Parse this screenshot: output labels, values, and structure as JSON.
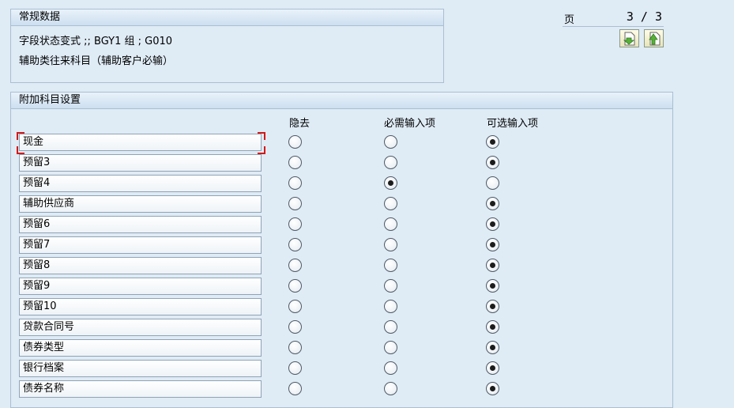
{
  "general": {
    "title": "常规数据",
    "field_status_line": "字段状态变式 ;; BGY1      组 ; G010",
    "description": "辅助类往来科目（辅助客户必输）"
  },
  "pager": {
    "label": "页",
    "value": "3 / 3",
    "prev_icon": "page-down-icon",
    "next_icon": "page-up-icon"
  },
  "settings": {
    "title": "附加科目设置",
    "columns": [
      "隐去",
      "必需输入项",
      "可选输入项"
    ],
    "rows": [
      {
        "label": "现金",
        "selected": 2
      },
      {
        "label": "预留3",
        "selected": 2
      },
      {
        "label": "预留4",
        "selected": 1
      },
      {
        "label": "辅助供应商",
        "selected": 2
      },
      {
        "label": "预留6",
        "selected": 2
      },
      {
        "label": "预留7",
        "selected": 2
      },
      {
        "label": "预留8",
        "selected": 2
      },
      {
        "label": "预留9",
        "selected": 2
      },
      {
        "label": "预留10",
        "selected": 2
      },
      {
        "label": "贷款合同号",
        "selected": 2
      },
      {
        "label": "债券类型",
        "selected": 2
      },
      {
        "label": "银行档案",
        "selected": 2
      },
      {
        "label": "债券名称",
        "selected": 2
      }
    ]
  },
  "colors": {
    "background": "#dfebf5",
    "border": "#a9bfd3",
    "focus": "#d21919"
  }
}
